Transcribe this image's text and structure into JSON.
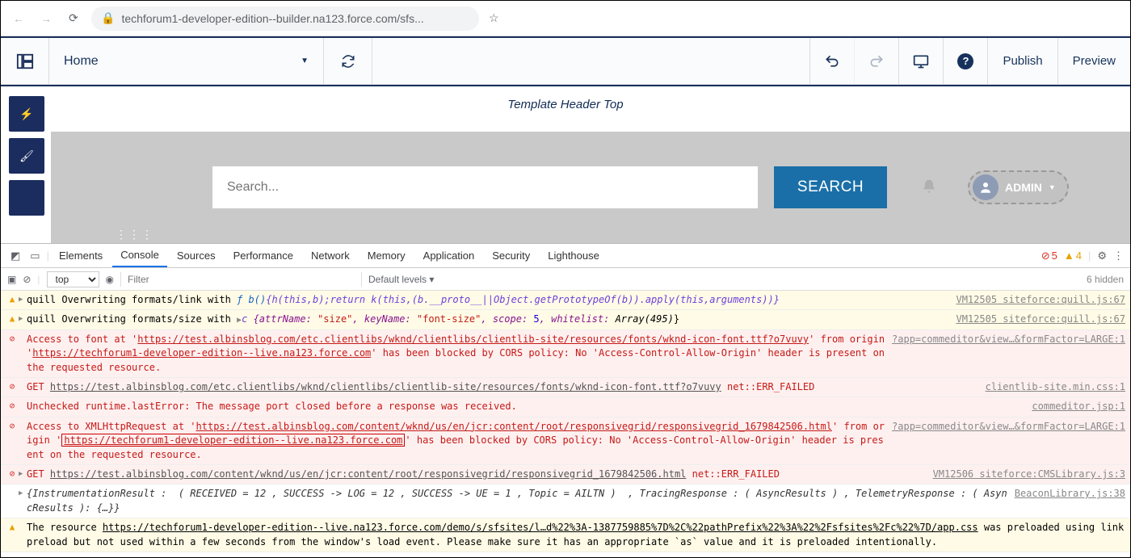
{
  "browser": {
    "url": "techforum1-developer-edition--builder.na123.force.com/sfs..."
  },
  "builder": {
    "page": "Home",
    "publish": "Publish",
    "preview": "Preview"
  },
  "canvas": {
    "template_label": "Template Header Top",
    "search_placeholder": "Search...",
    "search_btn": "SEARCH",
    "admin": "ADMIN"
  },
  "devtools": {
    "tabs": [
      "Elements",
      "Console",
      "Sources",
      "Performance",
      "Network",
      "Memory",
      "Application",
      "Security",
      "Lighthouse"
    ],
    "err_count": "5",
    "warn_count": "4",
    "context": "top",
    "filter_ph": "Filter",
    "levels": "Default levels ▾",
    "hidden": "6 hidden"
  },
  "logs": {
    "l1": {
      "pre": "quill Overwriting formats/link with ",
      "fn": "ƒ b()",
      "body": "{h(this,b);return k(this,(b.__proto__||Object.getPrototypeOf(b)).apply(this,arguments))}",
      "src": "VM12505 siteforce:quill.js:67"
    },
    "l2": {
      "pre": "quill Overwriting formats/size with ",
      "arrow": "▶",
      "obj": "c ",
      "body_open": "{attrName: ",
      "v1": "\"size\"",
      "k2": ", keyName: ",
      "v2": "\"font-size\"",
      "k3": ", scope: ",
      "v3": "5",
      "k4": ", whitelist: ",
      "v4": "Array(495)",
      "close": "}",
      "src": "VM12505 siteforce:quill.js:67"
    },
    "l3": {
      "a": "Access to font at '",
      "u1": "https://test.albinsblog.com/etc.clientlibs/wknd/clientlibs/clientlib-site/resources/fonts/wknd-icon-font.ttf?o7vuvy",
      "b": "' from origin '",
      "u2": "https://techforum1-developer-edition--live.na123.force.com",
      "c": "' has been blocked by CORS policy: No 'Access-Control-Allow-Origin' header is present on the requested resource.",
      "src": "?app=commeditor&view…&formFactor=LARGE:1"
    },
    "l4": {
      "a": "GET ",
      "u": "https://test.albinsblog.com/etc.clientlibs/wknd/clientlibs/clientlib-site/resources/fonts/wknd-icon-font.ttf?o7vuvy",
      "b": " net::ERR_FAILED",
      "src": "clientlib-site.min.css:1"
    },
    "l5": {
      "msg": "Unchecked runtime.lastError: The message port closed before a response was received.",
      "src": "commeditor.jsp:1"
    },
    "l6": {
      "a": "Access to XMLHttpRequest at '",
      "u1": "https://test.albinsblog.com/content/wknd/us/en/jcr:content/root/responsivegrid/responsivegrid_1679842506.html",
      "b": "' from origin '",
      "u2": "https://techforum1-developer-edition--live.na123.force.com",
      "c": "' has been blocked by CORS policy: No 'Access-Control-Allow-Origin' header is present on the requested resource.",
      "src": "?app=commeditor&view…&formFactor=LARGE:1"
    },
    "l7": {
      "a": "GET ",
      "u": "https://test.albinsblog.com/content/wknd/us/en/jcr:content/root/responsivegrid/responsivegrid_1679842506.html",
      "b": " net::ERR_FAILED",
      "src": "VM12506 siteforce:CMSLibrary.js:3"
    },
    "l8": {
      "body": "{InstrumentationResult :  ( RECEIVED = 12 , SUCCESS -> LOG = 12 , SUCCESS -> UE = 1 , Topic = AILTN )  , TracingResponse : ( AsyncResults ) , TelemetryResponse : ( AsyncResults ): {…}}",
      "src": "BeaconLibrary.js:38"
    },
    "l9": {
      "a": "The resource ",
      "u": "https://techforum1-developer-edition--live.na123.force.com/demo/s/sfsites/l…d%22%3A-1387759885%7D%2C%22pathPrefix%22%3A%22%2Fsfsites%2Fc%22%7D/app.css",
      "b": " was preloaded using link preload but not used within a few seconds from the window's load event. Please make sure it has an appropriate `as` value and it is preloaded intentionally."
    }
  }
}
